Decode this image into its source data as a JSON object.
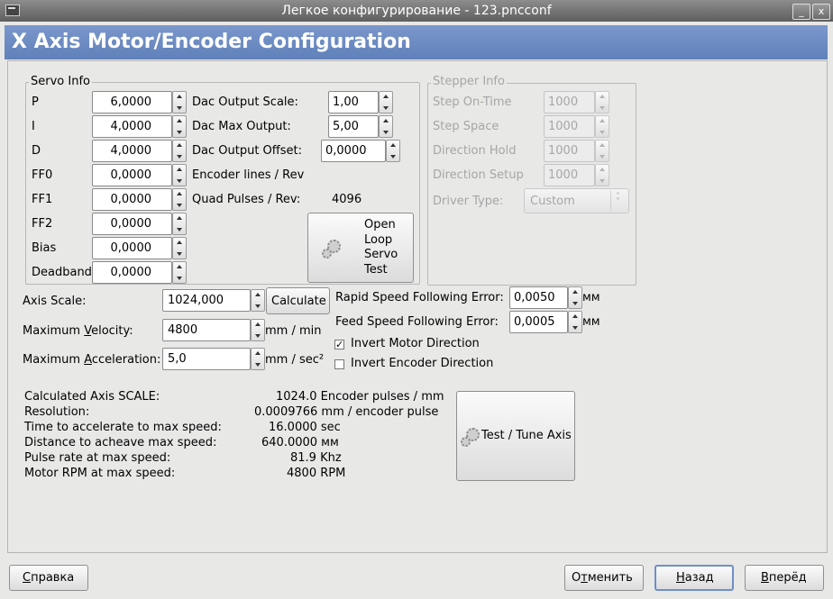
{
  "window": {
    "title": "Легкое конфигурирование - 123.pncconf",
    "minimize": "_",
    "close": "x"
  },
  "header": {
    "title": "X Axis Motor/Encoder Configuration"
  },
  "servo": {
    "legend": "Servo Info",
    "rows": [
      {
        "label": "P",
        "value": "6,0000"
      },
      {
        "label": "I",
        "value": "4,0000"
      },
      {
        "label": "D",
        "value": "4,0000"
      },
      {
        "label": "FF0",
        "value": "0,0000"
      },
      {
        "label": "FF1",
        "value": "0,0000"
      },
      {
        "label": "FF2",
        "value": "0,0000"
      },
      {
        "label": "Bias",
        "value": "0,0000"
      },
      {
        "label": "Deadband",
        "value": "0,0000"
      }
    ],
    "dac_scale": {
      "label": "Dac Output Scale:",
      "value": "1,00"
    },
    "dac_max": {
      "label": "Dac Max Output:",
      "value": "5,00"
    },
    "dac_offset": {
      "label": "Dac Output Offset:",
      "value": "0,0000"
    },
    "encoder_lines": {
      "label": "Encoder lines / Rev"
    },
    "quad_pulses": {
      "label": "Quad Pulses / Rev:",
      "value": "4096"
    },
    "open_loop_button": {
      "line1": "Open",
      "line2": "Loop",
      "line3": "Servo",
      "line4": "Test"
    }
  },
  "stepper": {
    "legend": "Stepper Info",
    "rows": [
      {
        "label": "Step On-Time",
        "value": "1000"
      },
      {
        "label": "Step Space",
        "value": "1000"
      },
      {
        "label": "Direction Hold",
        "value": "1000"
      },
      {
        "label": "Direction Setup",
        "value": "1000"
      }
    ],
    "driver_type": {
      "label": "Driver Type:",
      "value": "Custom"
    }
  },
  "axis": {
    "scale": {
      "label": "Axis Scale:",
      "value": "1024,000"
    },
    "calculate_button": "Calculate",
    "max_velocity": {
      "label_a": "Maximum ",
      "label_u": "V",
      "label_b": "elocity:",
      "value": "4800",
      "unit": "mm / min"
    },
    "max_accel": {
      "label_a": "Maximum ",
      "label_u": "A",
      "label_b": "cceleration:",
      "value": "5,0",
      "unit": "mm / sec²"
    },
    "rapid_ferror": {
      "label": "Rapid Speed Following Error:",
      "value": "0,0050",
      "unit": "мм"
    },
    "feed_ferror": {
      "label": "Feed Speed Following Error:",
      "value": "0,0005",
      "unit": "мм"
    },
    "invert_motor": {
      "label": "Invert Motor Direction",
      "checked": "✓"
    },
    "invert_encoder": {
      "label": "Invert Encoder Direction"
    }
  },
  "calc": {
    "rows": [
      {
        "label": "Calculated Axis SCALE:",
        "value": "1024.0 Encoder pulses / mm"
      },
      {
        "label": "Resolution:",
        "value": "0.0009766 mm / encoder pulse"
      },
      {
        "label": "Time to accelerate to max speed:",
        "value": "16.0000 sec"
      },
      {
        "label": "Distance to acheave max speed:",
        "value": "640.0000 мм"
      },
      {
        "label": "Pulse rate at max speed:",
        "value": "81.9 Khz"
      },
      {
        "label": "Motor RPM at max speed:",
        "value": "4800 RPM"
      }
    ],
    "test_button": "Test / Tune Axis"
  },
  "footer": {
    "help": {
      "u": "С",
      "rest": "правка"
    },
    "cancel": {
      "a": "О",
      "u": "т",
      "rest": "менить"
    },
    "back": {
      "u": "Н",
      "rest": "азад"
    },
    "forward": {
      "u": "В",
      "rest": "перёд"
    }
  }
}
